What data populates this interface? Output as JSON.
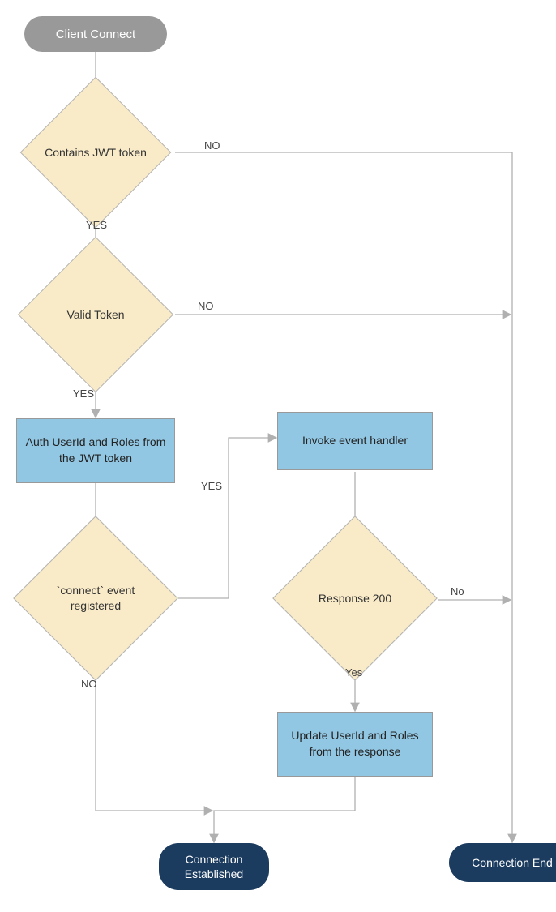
{
  "nodes": {
    "start": "Client Connect",
    "d1": "Contains JWT token",
    "d2": "Valid Token",
    "p1": "Auth UserId and Roles from the JWT token",
    "d3": "`connect` event registered",
    "p2": "Invoke event handler",
    "d4": "Response 200",
    "p3": "Update UserId and Roles from the response",
    "end_ok": "Connection Established",
    "end_fail": "Connection End"
  },
  "labels": {
    "d1_yes": "YES",
    "d1_no": "NO",
    "d2_yes": "YES",
    "d2_no": "NO",
    "d3_yes": "YES",
    "d3_no": "NO",
    "d4_yes": "Yes",
    "d4_no": "No"
  }
}
